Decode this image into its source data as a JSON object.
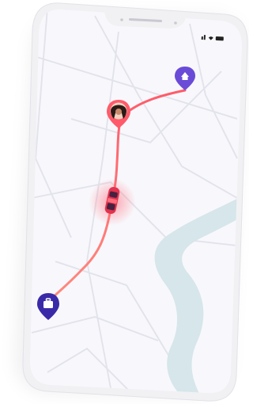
{
  "device": {
    "frame_color": "#f3f3f5",
    "screen_color": "#f7f7fb"
  },
  "map": {
    "road_color": "#e6e6ef",
    "river_color": "#d7e6ea",
    "route_color": "#ff5b6a"
  },
  "markers": {
    "home": {
      "icon": "home-icon",
      "color": "#6a4bd8"
    },
    "user": {
      "icon": "user-avatar",
      "color": "#ff5b6a"
    },
    "car": {
      "icon": "car-icon",
      "color": "#e2334f"
    },
    "work": {
      "icon": "briefcase-icon",
      "color": "#3b2aa8"
    }
  }
}
